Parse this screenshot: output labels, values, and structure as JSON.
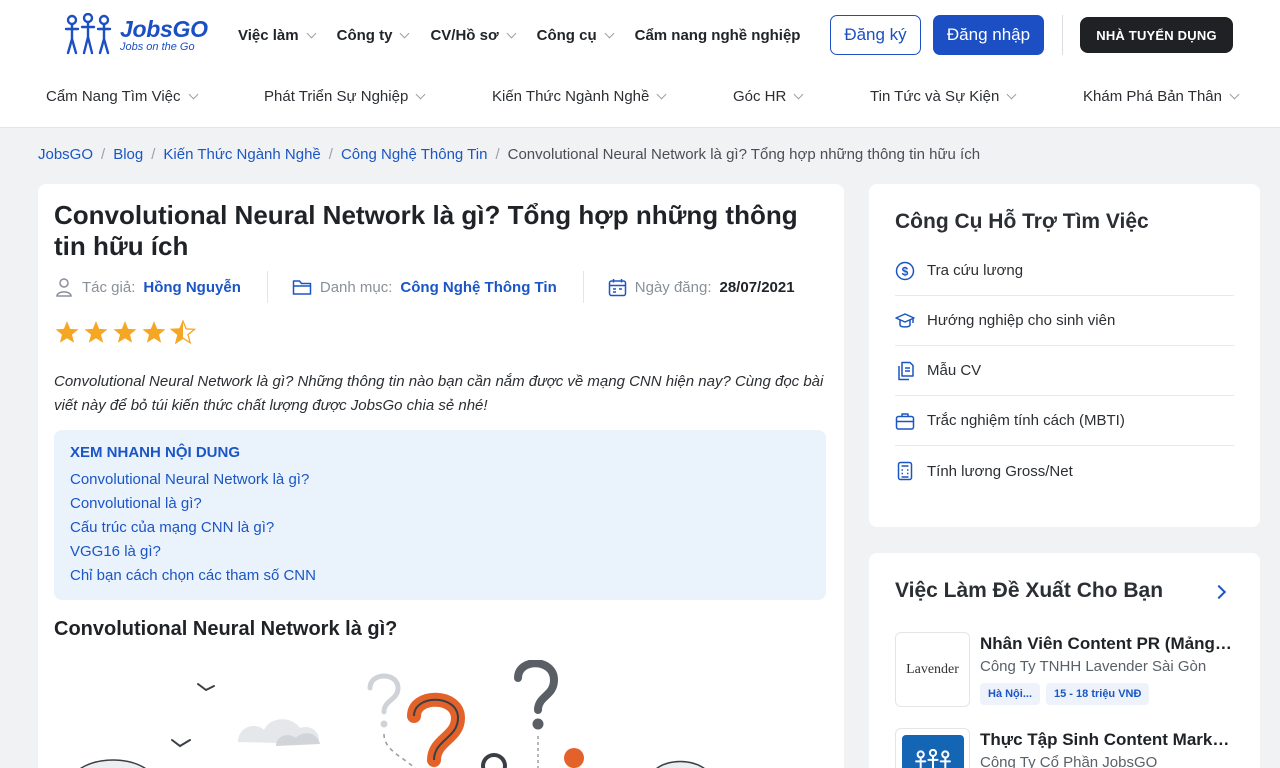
{
  "brand": {
    "name": "JobsGO",
    "tagline": "Jobs on the Go"
  },
  "topnav": [
    {
      "label": "Việc làm"
    },
    {
      "label": "Công ty"
    },
    {
      "label": "CV/Hồ sơ"
    },
    {
      "label": "Công cụ"
    },
    {
      "label": "Cẩm nang nghề nghiệp"
    }
  ],
  "auth": {
    "register": "Đăng ký",
    "login": "Đăng nhập",
    "employer": "NHÀ TUYỂN DỤNG"
  },
  "subnav": [
    {
      "label": "Cẩm Nang Tìm Việc"
    },
    {
      "label": "Phát Triển Sự Nghiệp"
    },
    {
      "label": "Kiến Thức Ngành Nghề"
    },
    {
      "label": "Góc HR"
    },
    {
      "label": "Tin Tức và Sự Kiện"
    },
    {
      "label": "Khám Phá Bản Thân"
    }
  ],
  "breadcrumb": {
    "items": [
      "JobsGO",
      "Blog",
      "Kiến Thức Ngành Nghề",
      "Công Nghệ Thông Tin"
    ],
    "current": "Convolutional Neural Network là gì? Tổng hợp những thông tin hữu ích",
    "separator": "/"
  },
  "article": {
    "title": "Convolutional Neural Network là gì? Tổng hợp những thông tin hữu ích",
    "author_label": "Tác giả:",
    "author": "Hồng Nguyễn",
    "category_label": "Danh mục:",
    "category": "Công Nghệ Thông Tin",
    "date_label": "Ngày đăng:",
    "date": "28/07/2021",
    "rating": 4.5,
    "intro": "Convolutional Neural Network là gì? Những thông tin nào bạn cần nắm được về mạng CNN hiện nay? Cùng đọc bài viết này để bỏ túi kiến thức chất lượng được JobsGo chia sẻ nhé!",
    "toc_title": "XEM NHANH NỘI DUNG",
    "toc": [
      "Convolutional Neural Network là gì?",
      "Convolutional là gì?",
      "Cấu trúc của mạng CNN là gì?",
      "VGG16 là gì?",
      "Chỉ bạn cách chọn các tham số CNN"
    ],
    "section_heading": "Convolutional Neural Network là gì?"
  },
  "tools": {
    "heading": "Công Cụ Hỗ Trợ Tìm Việc",
    "items": [
      {
        "label": "Tra cứu lương",
        "icon": "salary-icon"
      },
      {
        "label": "Hướng nghiệp cho sinh viên",
        "icon": "graduation-cap-icon"
      },
      {
        "label": "Mẫu CV",
        "icon": "documents-icon"
      },
      {
        "label": "Trắc nghiệm tính cách (MBTI)",
        "icon": "briefcase-icon"
      },
      {
        "label": "Tính lương Gross/Net",
        "icon": "calculator-icon"
      }
    ]
  },
  "jobs": {
    "heading": "Việc Làm Đề Xuất Cho Bạn",
    "items": [
      {
        "title": "Nhân Viên Content PR (Mảng Làm Đẹp)",
        "company": "Công Ty TNHH Lavender Sài Gòn",
        "location": "Hà Nội...",
        "salary": "15 - 18 triệu VNĐ",
        "logo_text": "Lavender"
      },
      {
        "title": "Thực Tập Sinh Content Marketing",
        "company": "Công Ty Cổ Phần JobsGO"
      }
    ]
  },
  "colors": {
    "primary": "#1c4fc4",
    "link": "#1b56c4",
    "dark": "#1f2125",
    "star": "#f5a623",
    "toc_bg": "#eaf2fc"
  }
}
